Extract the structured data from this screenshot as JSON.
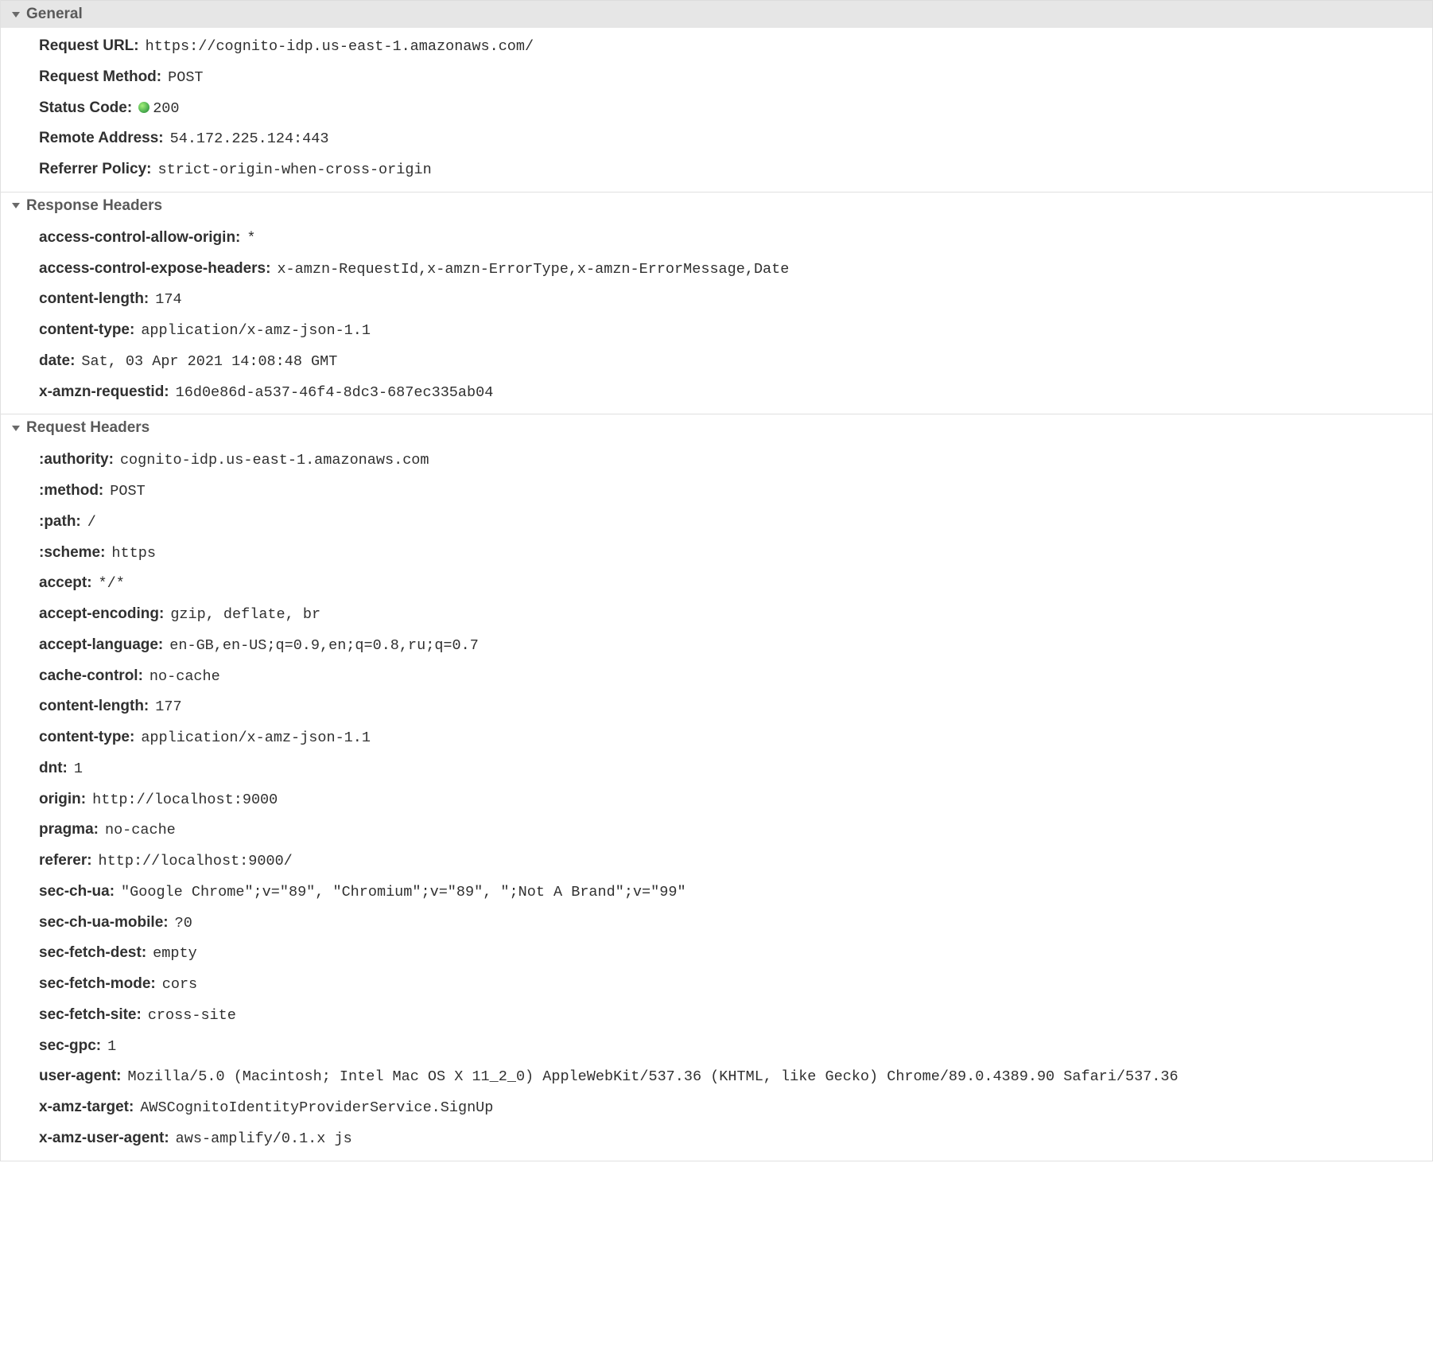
{
  "sections": {
    "general": {
      "title": "General",
      "rows": [
        {
          "key": "Request URL:",
          "val": "https://cognito-idp.us-east-1.amazonaws.com/"
        },
        {
          "key": "Request Method:",
          "val": "POST"
        },
        {
          "key": "Status Code:",
          "val": "200",
          "statusDot": true
        },
        {
          "key": "Remote Address:",
          "val": "54.172.225.124:443"
        },
        {
          "key": "Referrer Policy:",
          "val": "strict-origin-when-cross-origin"
        }
      ]
    },
    "response": {
      "title": "Response Headers",
      "rows": [
        {
          "key": "access-control-allow-origin:",
          "val": "*"
        },
        {
          "key": "access-control-expose-headers:",
          "val": "x-amzn-RequestId,x-amzn-ErrorType,x-amzn-ErrorMessage,Date"
        },
        {
          "key": "content-length:",
          "val": "174"
        },
        {
          "key": "content-type:",
          "val": "application/x-amz-json-1.1"
        },
        {
          "key": "date:",
          "val": "Sat, 03 Apr 2021 14:08:48 GMT"
        },
        {
          "key": "x-amzn-requestid:",
          "val": "16d0e86d-a537-46f4-8dc3-687ec335ab04"
        }
      ]
    },
    "request": {
      "title": "Request Headers",
      "rows": [
        {
          "key": ":authority:",
          "val": "cognito-idp.us-east-1.amazonaws.com"
        },
        {
          "key": ":method:",
          "val": "POST"
        },
        {
          "key": ":path:",
          "val": "/"
        },
        {
          "key": ":scheme:",
          "val": "https"
        },
        {
          "key": "accept:",
          "val": "*/*"
        },
        {
          "key": "accept-encoding:",
          "val": "gzip, deflate, br"
        },
        {
          "key": "accept-language:",
          "val": "en-GB,en-US;q=0.9,en;q=0.8,ru;q=0.7"
        },
        {
          "key": "cache-control:",
          "val": "no-cache"
        },
        {
          "key": "content-length:",
          "val": "177"
        },
        {
          "key": "content-type:",
          "val": "application/x-amz-json-1.1"
        },
        {
          "key": "dnt:",
          "val": "1"
        },
        {
          "key": "origin:",
          "val": "http://localhost:9000"
        },
        {
          "key": "pragma:",
          "val": "no-cache"
        },
        {
          "key": "referer:",
          "val": "http://localhost:9000/"
        },
        {
          "key": "sec-ch-ua:",
          "val": "\"Google Chrome\";v=\"89\", \"Chromium\";v=\"89\", \";Not A Brand\";v=\"99\""
        },
        {
          "key": "sec-ch-ua-mobile:",
          "val": "?0"
        },
        {
          "key": "sec-fetch-dest:",
          "val": "empty"
        },
        {
          "key": "sec-fetch-mode:",
          "val": "cors"
        },
        {
          "key": "sec-fetch-site:",
          "val": "cross-site"
        },
        {
          "key": "sec-gpc:",
          "val": "1"
        },
        {
          "key": "user-agent:",
          "val": "Mozilla/5.0 (Macintosh; Intel Mac OS X 11_2_0) AppleWebKit/537.36 (KHTML, like Gecko) Chrome/89.0.4389.90 Safari/537.36"
        },
        {
          "key": "x-amz-target:",
          "val": "AWSCognitoIdentityProviderService.SignUp"
        },
        {
          "key": "x-amz-user-agent:",
          "val": "aws-amplify/0.1.x js"
        }
      ]
    }
  }
}
